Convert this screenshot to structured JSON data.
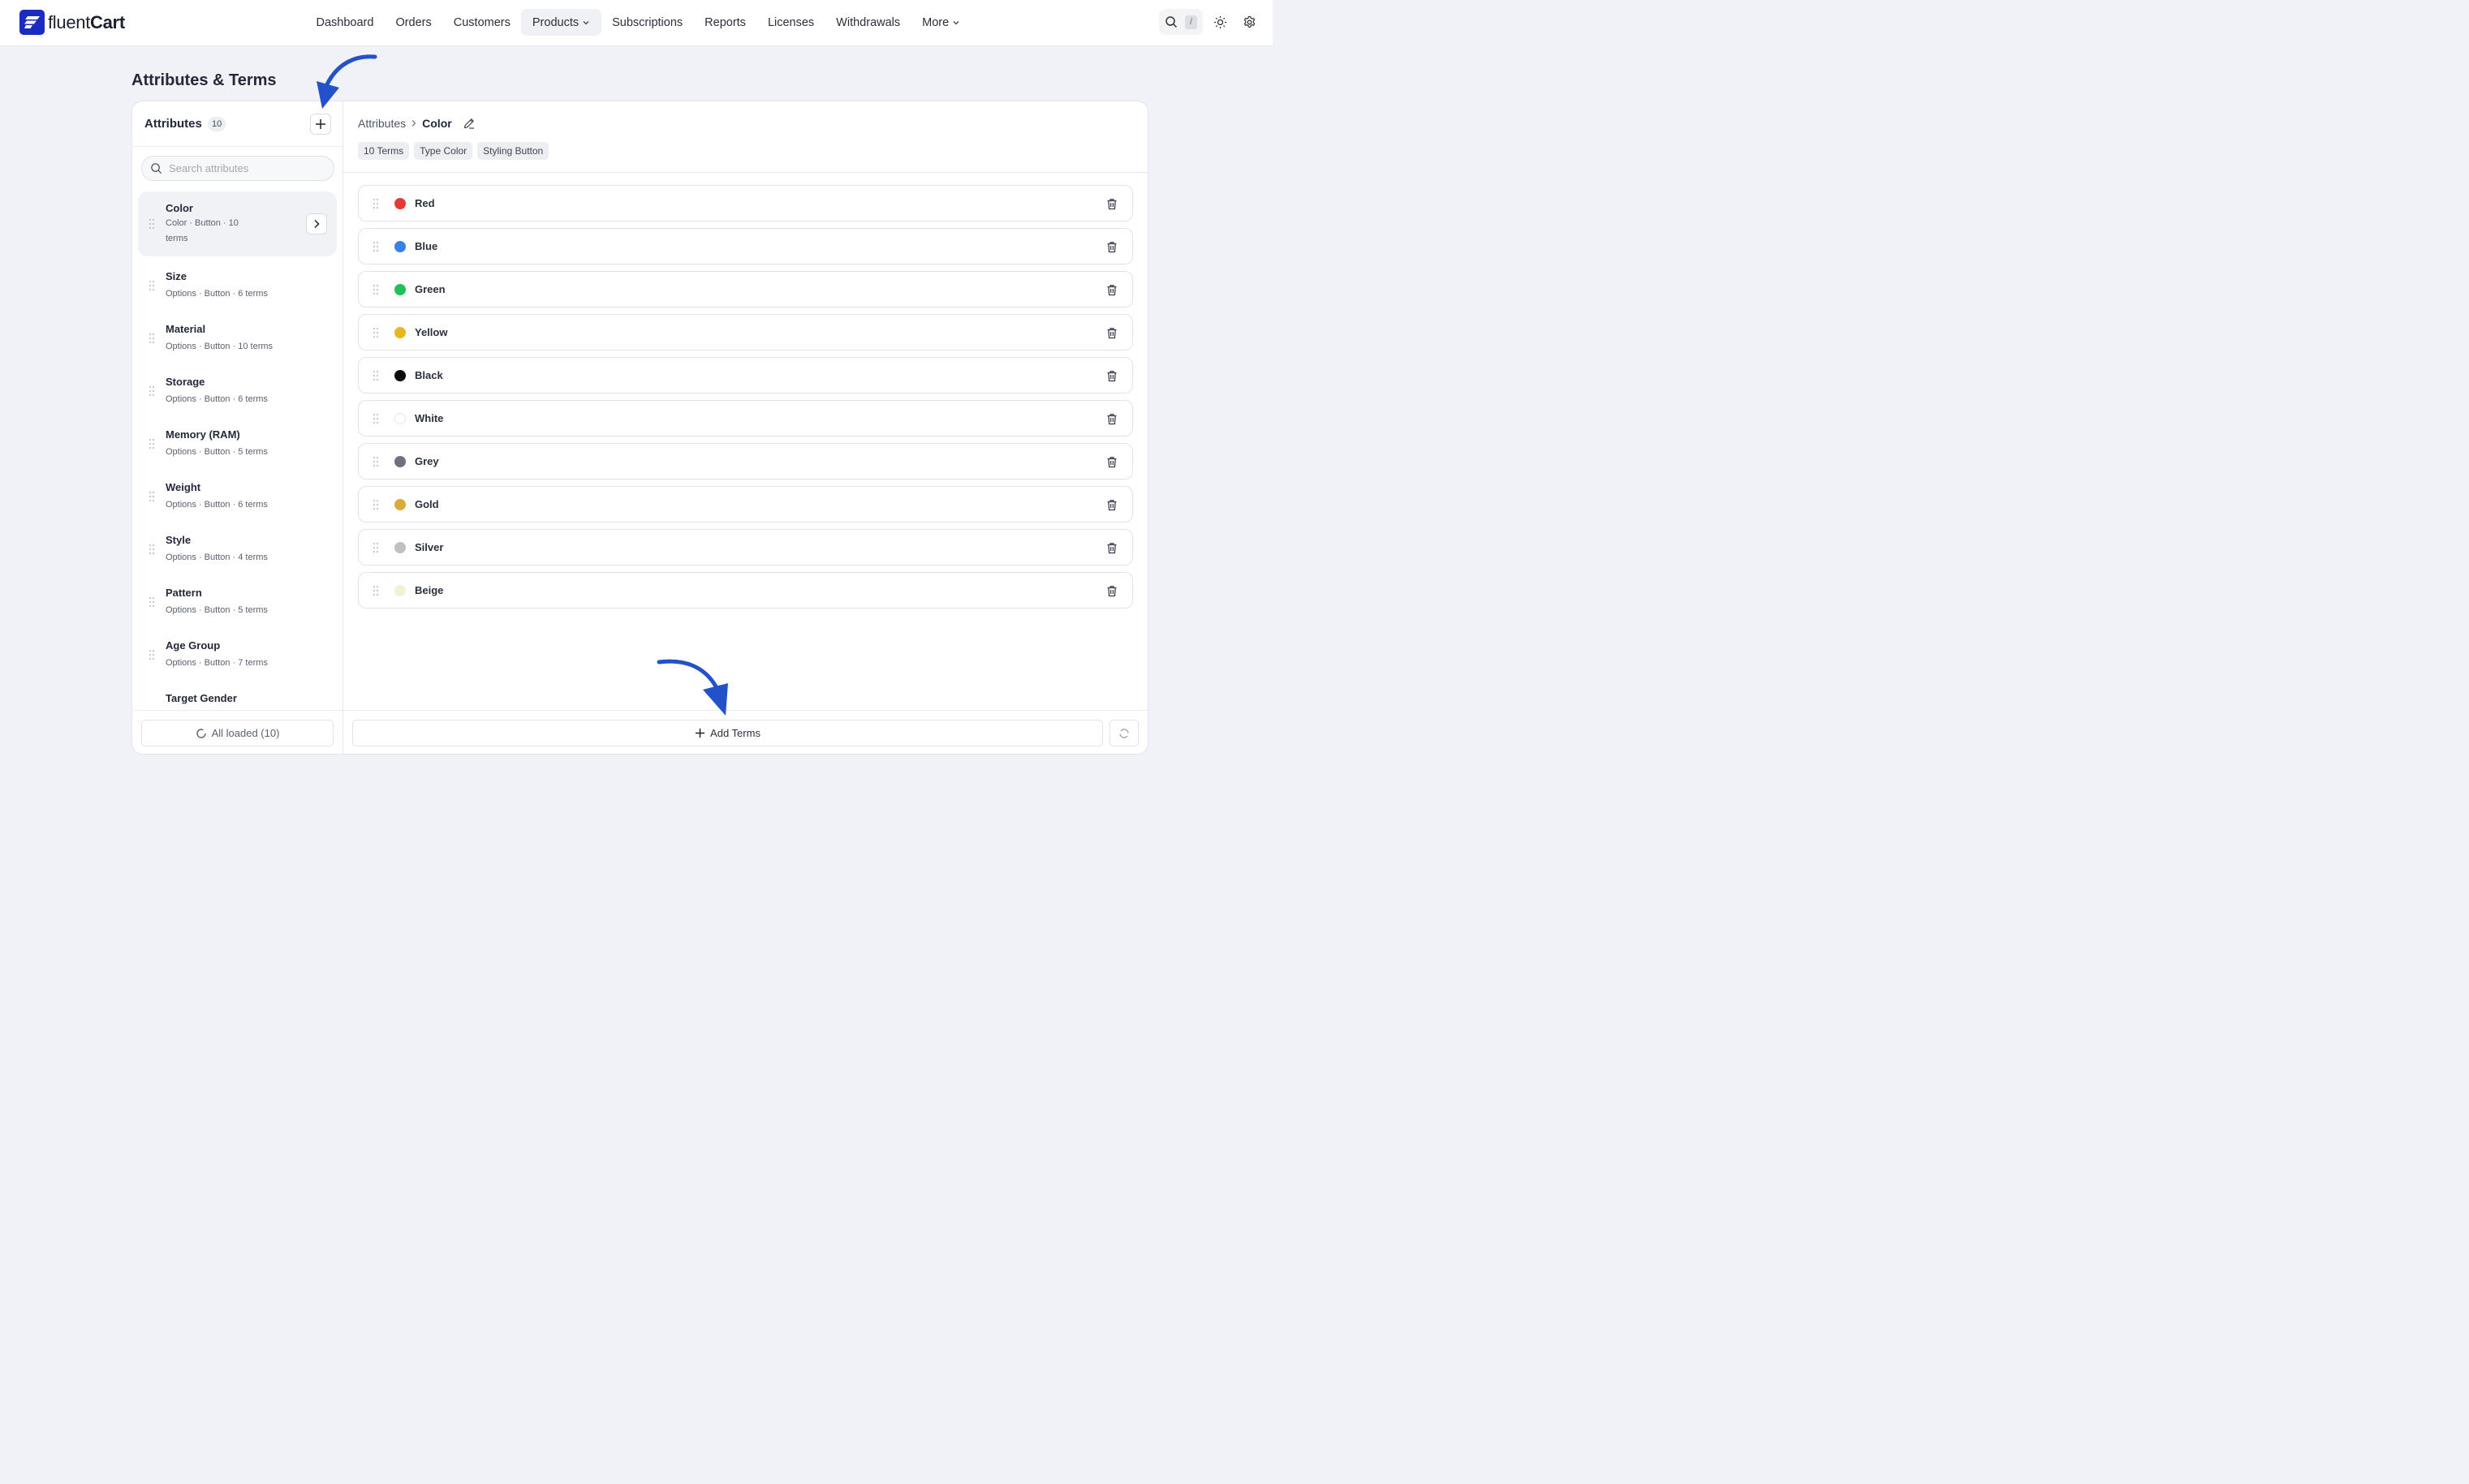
{
  "app": {
    "brand_light": "fluent",
    "brand_bold": "Cart",
    "brand_color": "#1b2cc1"
  },
  "nav": {
    "items": [
      {
        "label": "Dashboard"
      },
      {
        "label": "Orders"
      },
      {
        "label": "Customers"
      },
      {
        "label": "Products",
        "active": true
      },
      {
        "label": "Subscriptions"
      },
      {
        "label": "Reports"
      },
      {
        "label": "Licenses"
      },
      {
        "label": "Withdrawals"
      },
      {
        "label": "More"
      }
    ],
    "search_shortcut": "/"
  },
  "page": {
    "title": "Attributes & Terms"
  },
  "attributes_panel": {
    "title": "Attributes",
    "count": "10",
    "search_placeholder": "Search attributes",
    "items": [
      {
        "name": "Color",
        "meta": "Color · Button · 10 terms",
        "selected": true
      },
      {
        "name": "Size",
        "meta": "Options · Button · 6 terms"
      },
      {
        "name": "Material",
        "meta": "Options · Button · 10 terms"
      },
      {
        "name": "Storage",
        "meta": "Options · Button · 6 terms"
      },
      {
        "name": "Memory (RAM)",
        "meta": "Options · Button · 5 terms"
      },
      {
        "name": "Weight",
        "meta": "Options · Button · 6 terms"
      },
      {
        "name": "Style",
        "meta": "Options · Button · 4 terms"
      },
      {
        "name": "Pattern",
        "meta": "Options · Button · 5 terms"
      },
      {
        "name": "Age Group",
        "meta": "Options · Button · 7 terms"
      },
      {
        "name": "Target Gender",
        "meta": ""
      }
    ],
    "footer_label": "All loaded (10)"
  },
  "detail": {
    "breadcrumb_root": "Attributes",
    "breadcrumb_current": "Color",
    "tags": [
      "10 Terms",
      "Type Color",
      "Styling Button"
    ],
    "terms": [
      {
        "name": "Red",
        "color": "#e53935"
      },
      {
        "name": "Blue",
        "color": "#3b7fe8"
      },
      {
        "name": "Green",
        "color": "#22c05a"
      },
      {
        "name": "Yellow",
        "color": "#e8b820"
      },
      {
        "name": "Black",
        "color": "#0b0b0b"
      },
      {
        "name": "White",
        "color": "#ffffff"
      },
      {
        "name": "Grey",
        "color": "#6e7280"
      },
      {
        "name": "Gold",
        "color": "#d8ac3a"
      },
      {
        "name": "Silver",
        "color": "#c0c0c3"
      },
      {
        "name": "Beige",
        "color": "#f3f0d6"
      }
    ],
    "add_terms_label": "Add Terms"
  }
}
